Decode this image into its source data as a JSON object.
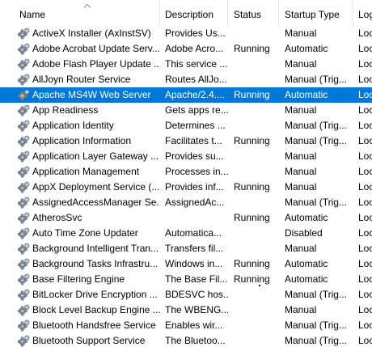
{
  "columns": {
    "name": "Name",
    "description": "Description",
    "status": "Status",
    "startup_type": "Startup Type",
    "log_on_as": "Log"
  },
  "sort": {
    "column": "name",
    "direction": "ascending"
  },
  "selected_row": 4,
  "colors": {
    "selection": "#0078d7",
    "selection_text": "#ffffff"
  },
  "icons": {
    "service": "gear-icon",
    "sort": "sort-ascending-icon"
  },
  "rows": [
    {
      "name": "ActiveX Installer (AxInstSV)",
      "description": "Provides Us...",
      "status": "",
      "startup": "Manual",
      "logon": "Loc"
    },
    {
      "name": "Adobe Acrobat Update Serv...",
      "description": "Adobe Acro...",
      "status": "Running",
      "startup": "Automatic",
      "logon": "Loc"
    },
    {
      "name": "Adobe Flash Player Update ...",
      "description": "This service ...",
      "status": "",
      "startup": "Manual",
      "logon": "Loc"
    },
    {
      "name": "AllJoyn Router Service",
      "description": "Routes AllJo...",
      "status": "",
      "startup": "Manual (Trig...",
      "logon": "Loc"
    },
    {
      "name": "Apache MS4W Web Server",
      "description": "Apache/2.4....",
      "status": "Running",
      "startup": "Automatic",
      "logon": "Loc"
    },
    {
      "name": "App Readiness",
      "description": "Gets apps re...",
      "status": "",
      "startup": "Manual",
      "logon": "Loc"
    },
    {
      "name": "Application Identity",
      "description": "Determines ...",
      "status": "",
      "startup": "Manual (Trig...",
      "logon": "Loc"
    },
    {
      "name": "Application Information",
      "description": "Facilitates t...",
      "status": "Running",
      "startup": "Manual (Trig...",
      "logon": "Loc"
    },
    {
      "name": "Application Layer Gateway ...",
      "description": "Provides su...",
      "status": "",
      "startup": "Manual",
      "logon": "Loc"
    },
    {
      "name": "Application Management",
      "description": "Processes in...",
      "status": "",
      "startup": "Manual",
      "logon": "Loc"
    },
    {
      "name": "AppX Deployment Service (...",
      "description": "Provides inf...",
      "status": "Running",
      "startup": "Manual",
      "logon": "Loc"
    },
    {
      "name": "AssignedAccessManager Se...",
      "description": "AssignedAc...",
      "status": "",
      "startup": "Manual (Trig...",
      "logon": "Loc"
    },
    {
      "name": "AtherosSvc",
      "description": "",
      "status": "Running",
      "startup": "Automatic",
      "logon": "Loc"
    },
    {
      "name": "Auto Time Zone Updater",
      "description": "Automatica...",
      "status": "",
      "startup": "Disabled",
      "logon": "Loc"
    },
    {
      "name": "Background Intelligent Tran...",
      "description": "Transfers fil...",
      "status": "",
      "startup": "Manual",
      "logon": "Loc"
    },
    {
      "name": "Background Tasks Infrastru...",
      "description": "Windows in...",
      "status": "Running",
      "startup": "Automatic",
      "logon": "Loc"
    },
    {
      "name": "Base Filtering Engine",
      "description": "The Base Fil...",
      "status": "Running",
      "startup": "Automatic",
      "logon": "Loc"
    },
    {
      "name": "BitLocker Drive Encryption ...",
      "description": "BDESVC hos...",
      "status": "",
      "startup": "Manual (Trig...",
      "logon": "Loc"
    },
    {
      "name": "Block Level Backup Engine ...",
      "description": "The WBENG...",
      "status": "",
      "startup": "Manual",
      "logon": "Loc"
    },
    {
      "name": "Bluetooth Handsfree Service",
      "description": "Enables wir...",
      "status": "",
      "startup": "Manual (Trig...",
      "logon": "Loc"
    },
    {
      "name": "Bluetooth Support Service",
      "description": "The Bluetoo...",
      "status": "",
      "startup": "Manual (Trig...",
      "logon": "Loc"
    }
  ]
}
